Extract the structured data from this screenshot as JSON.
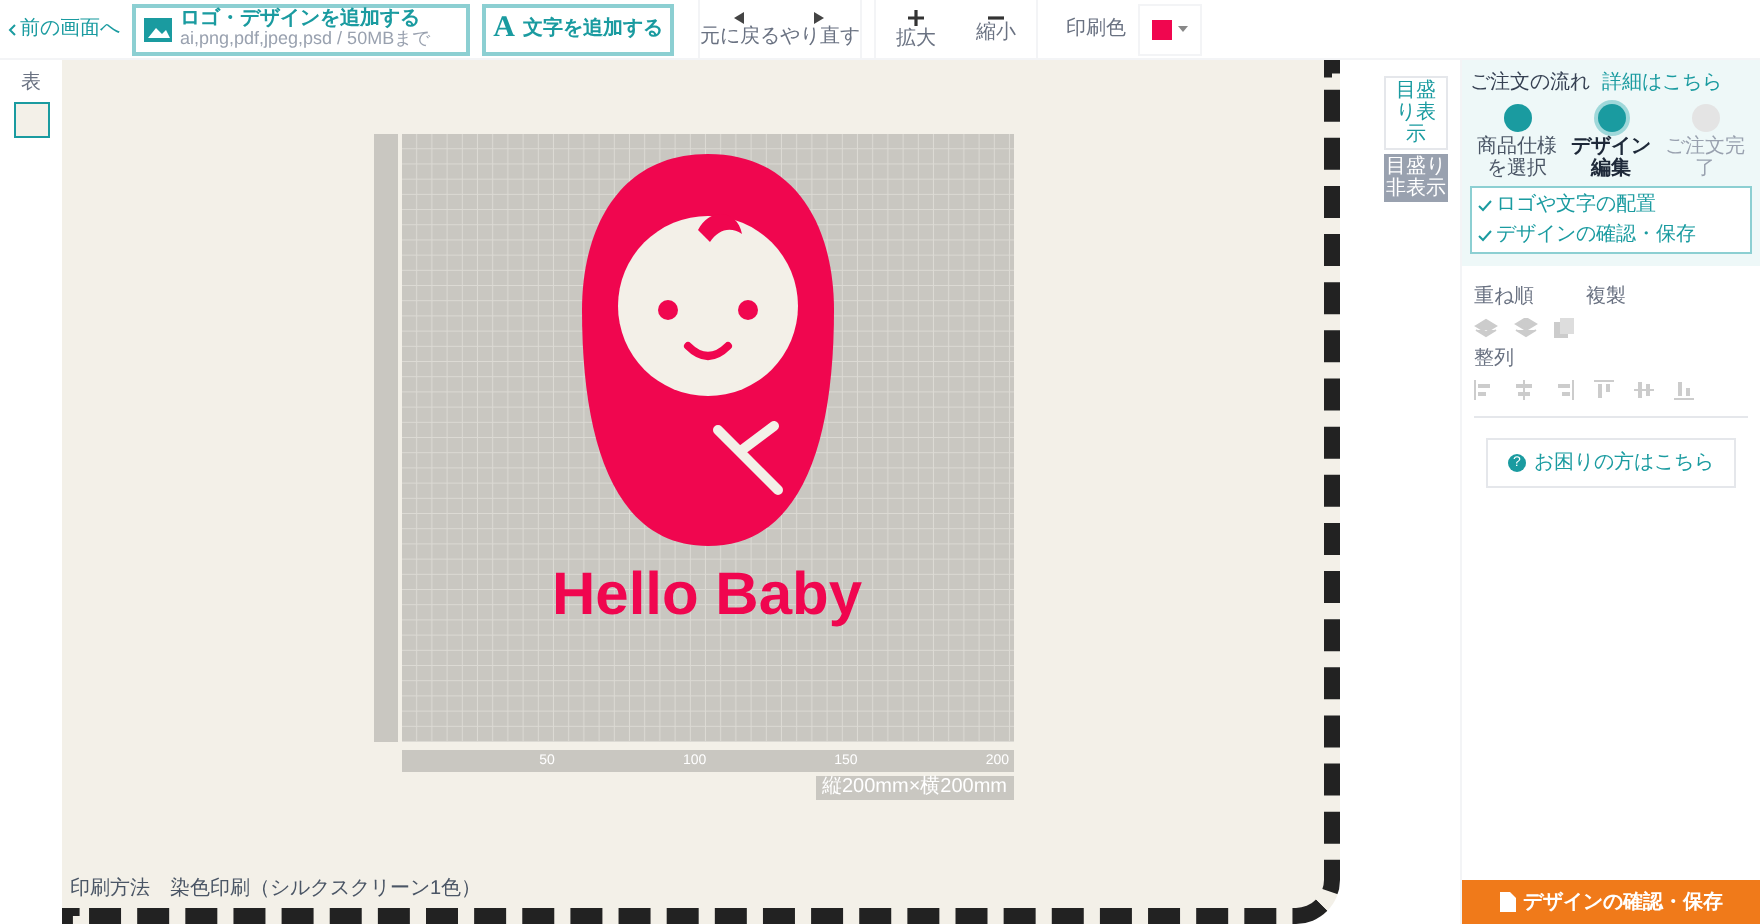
{
  "toolbar": {
    "back": "前の画面へ",
    "add_logo": {
      "label": "ロゴ・デザインを追加する",
      "note": "ai,png,pdf,jpeg,psd / 50MBまで"
    },
    "add_text_icon": "A",
    "add_text": "文字を追加する",
    "undo": "元に戻る",
    "redo": "やり直す",
    "zoom_in": "拡大",
    "zoom_out": "縮小",
    "print_color_label": "印刷色",
    "print_color": {
      "color": "#f0064f"
    }
  },
  "sides": [
    {
      "label": "表",
      "selected": true
    }
  ],
  "scale_buttons": [
    {
      "label": "目盛り表示",
      "selected": false
    },
    {
      "label": "目盛り非表示",
      "selected": true
    }
  ],
  "design": {
    "text": "Hello Baby",
    "color": "#f0064f"
  },
  "ruler": {
    "x_labels": [
      "50",
      "100",
      "150",
      "200"
    ],
    "size": "縦200mm×横200mm"
  },
  "print_info": {
    "label": "印刷方法",
    "value": "染色印刷（シルクスクリーン1色）"
  },
  "order_flow": {
    "title": "ご注文の流れ",
    "details_link": "詳細はこちら",
    "steps": [
      {
        "label": "商品仕様を選択",
        "done": true,
        "selected": false
      },
      {
        "label": "デザイン編集",
        "done": false,
        "selected": true
      },
      {
        "label": "ご注文完了",
        "done": false,
        "selected": false
      }
    ],
    "substeps": [
      "ロゴや文字の配置",
      "デザインの確認・保存"
    ]
  },
  "arrange": {
    "order_label": "重ね順",
    "duplicate_label": "複製",
    "align_label": "整列"
  },
  "help_icon": "?",
  "help_button": "お困りの方はこちら",
  "save_button": "デザインの確認・保存"
}
